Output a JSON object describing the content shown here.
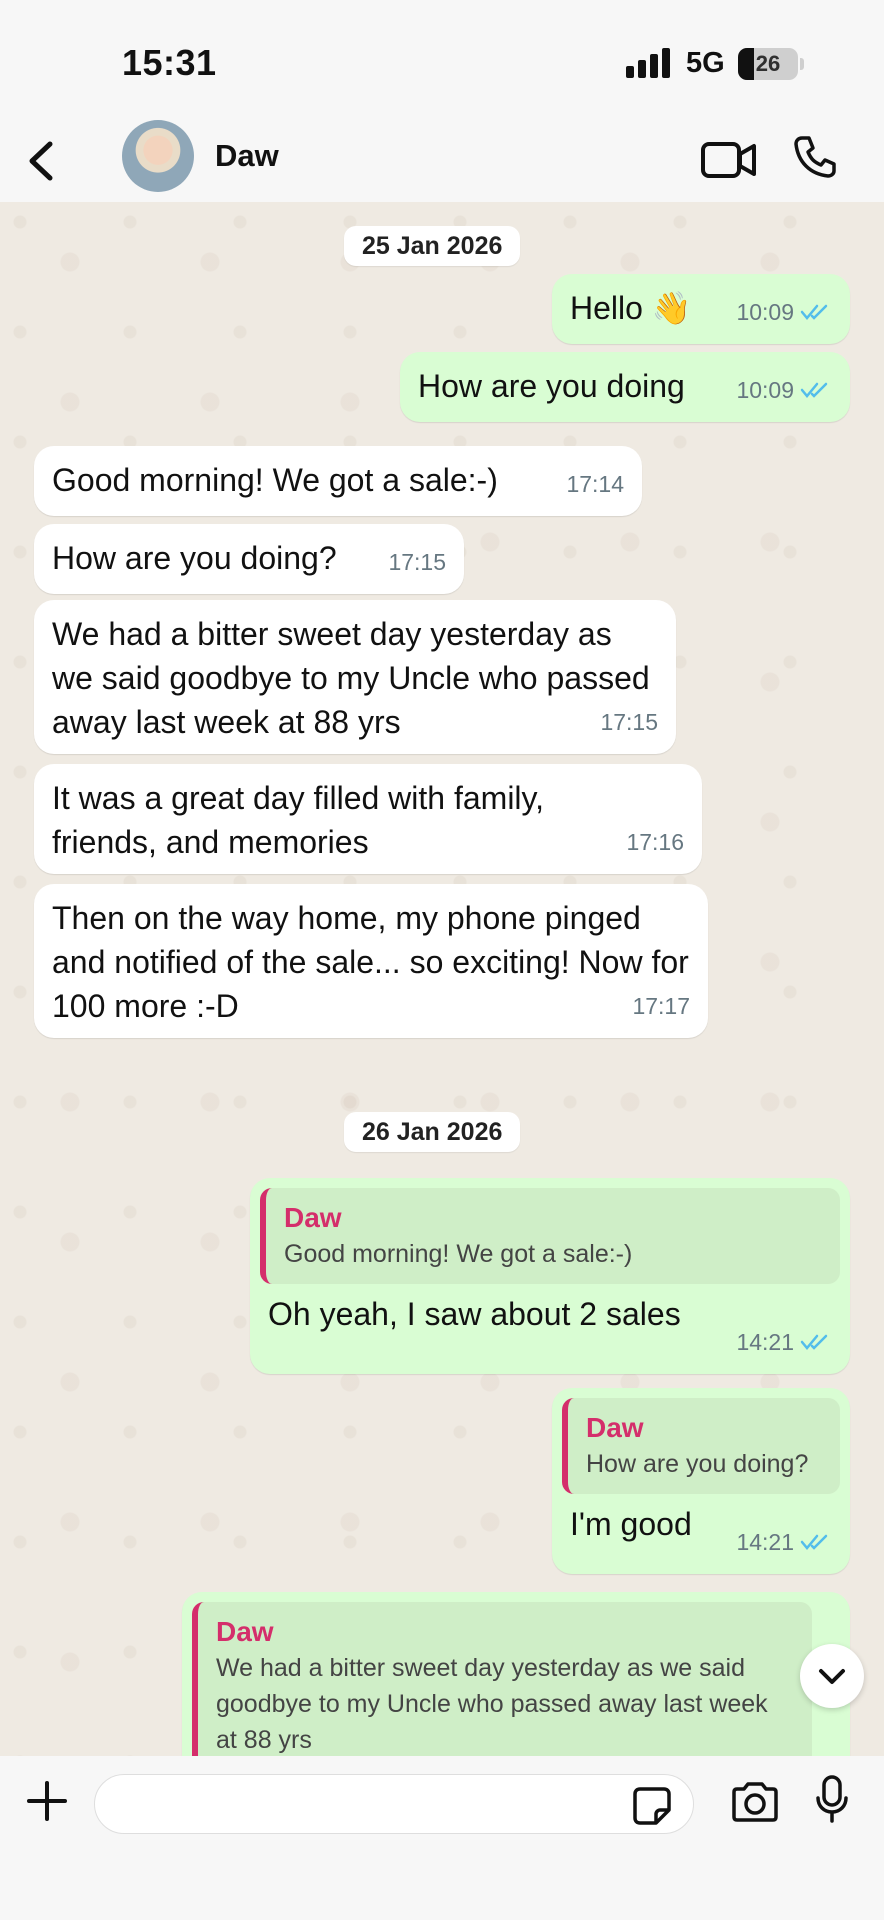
{
  "status_bar": {
    "time": "15:31",
    "network": "5G",
    "battery_level": "26",
    "battery_fraction": 0.26
  },
  "header": {
    "contact_name": "Daw",
    "icons": {
      "back": "chevron-left-icon",
      "video": "video-camera-icon",
      "call": "phone-icon"
    }
  },
  "chat": {
    "date_separators": [
      "25 Jan 2026",
      "26 Jan 2026"
    ],
    "messages": [
      {
        "direction": "out",
        "text": "Hello 👋",
        "time": "10:09",
        "status": "read"
      },
      {
        "direction": "out",
        "text": "How are you doing",
        "time": "10:09",
        "status": "read"
      },
      {
        "direction": "in",
        "text": "Good morning! We got a sale:-)",
        "time": "17:14"
      },
      {
        "direction": "in",
        "text": "How are you doing?",
        "time": "17:15"
      },
      {
        "direction": "in",
        "text": "We had a bitter sweet day yesterday as we said goodbye to my Uncle who passed away last week at 88 yrs",
        "time": "17:15"
      },
      {
        "direction": "in",
        "text": "It was a great day filled with family, friends, and memories",
        "time": "17:16"
      },
      {
        "direction": "in",
        "text": "Then on the way home, my phone pinged and notified of the sale... so exciting! Now for 100 more :-D",
        "time": "17:17"
      },
      {
        "direction": "out",
        "reply_to": {
          "name": "Daw",
          "text": "Good morning! We got a sale:-)"
        },
        "text": "Oh yeah, I saw about 2 sales",
        "time": "14:21",
        "status": "read"
      },
      {
        "direction": "out",
        "reply_to": {
          "name": "Daw",
          "text": "How are you doing?"
        },
        "text": "I'm good",
        "time": "14:21",
        "status": "read"
      },
      {
        "direction": "out",
        "reply_to": {
          "name": "Daw",
          "text": "We had a bitter sweet day yesterday as we said goodbye to my Uncle who passed away last week at 88 yrs"
        }
      }
    ]
  },
  "composer": {
    "value": "",
    "icons": {
      "attach": "plus-icon",
      "sticker": "sticker-icon",
      "camera": "camera-icon",
      "mic": "microphone-icon",
      "scroll": "chevron-down-icon"
    }
  },
  "colors": {
    "outgoing_bubble": "#d9fdd3",
    "incoming_bubble": "#ffffff",
    "chat_background": "#efeae2",
    "read_tick": "#53bdeb",
    "reply_accent": "#d42e6b"
  }
}
